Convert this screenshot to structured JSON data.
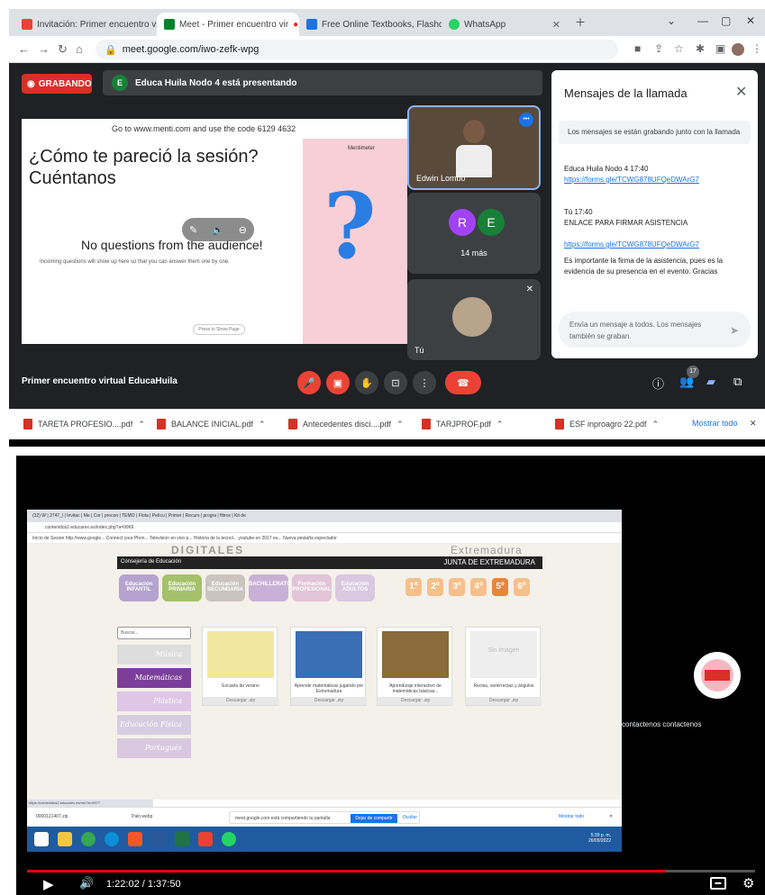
{
  "browser": {
    "tabs": [
      {
        "label": "Invitación: Primer encuentro virt",
        "color": "#ea4335"
      },
      {
        "label": "Meet - Primer encuentro vir",
        "color": "#00832d"
      },
      {
        "label": "Free Online Textbooks, Flashcard",
        "color": "#1a73e8"
      },
      {
        "label": "WhatsApp",
        "color": "#25d366"
      }
    ],
    "url": "meet.google.com/iwo-zefk-wpg"
  },
  "meet": {
    "recording_label": "GRABANDO",
    "presenter_initial": "E",
    "presenting_text": "Educa Huila Nodo 4 está presentando",
    "meeting_title": "Primer encuentro virtual EducaHuila",
    "participants_badge": "17",
    "slide": {
      "code_line": "Go to www.menti.com and use the code 6129 4632",
      "question": "¿Cómo te pareció la sesión? Cuéntanos",
      "brand": "Mentimeter",
      "qmark": "?",
      "no_questions": "No questions from the audience!",
      "incoming": "Incoming questions will show up here so that you can answer them one by one.",
      "small_btn": "Press to Show Page"
    },
    "tiles": {
      "t1_name": "Edwin Lombo",
      "t2_initials": [
        "R",
        "E"
      ],
      "t2_more": "14 más",
      "t3_name": "Tú"
    },
    "chat": {
      "title": "Mensajes de la llamada",
      "note": "Los mensajes se están grabando junto con la llamada",
      "m1_sender": "Educa Huila Nodo 4  17:40",
      "m1_link": "https://forms.gle/TCWG878UFQeDWArG7",
      "m2_sender": "Tú  17:40",
      "m2_text": "ENLACE PARA FIRMAR ASISTENCIA",
      "m2_link": "https://forms.gle/TCWG878UFQeDWArG7",
      "m2_text2": "Es importante la firma de la asistencia, pues es la evidencia de su presencia en el evento. Gracias",
      "input_placeholder": "Envía un mensaje a todos. Los mensajes también se graban."
    }
  },
  "downloads": {
    "items": [
      "TARETA PROFESIO....pdf",
      "BALANCE INICIAL.pdf",
      "Antecedentes disci....pdf",
      "TARJPROF.pdf",
      "ESF inproagro 22.pdf"
    ],
    "show_all": "Mostrar todo"
  },
  "shared": {
    "tabs_text": "(32) W  |  2747_l  |  Invitac  |  Me  |  Cor  |  procon  |  TEMO  |  Flota  |  Pelícu  |  Primer  |  Recurs  |  progra  |  filtros  |  Kit de",
    "url": "contenidos2.educarex.es/index.php?a=9969",
    "bookmarks": "Inicio de Sesion   http://www.google...   Connect your Phon...   Television en vivo p...   Historia de la tecnol...   youtube en 2017 eu...   Nueva pestaña   espectador",
    "brand_left": "DIGITALES",
    "brand_right": "Extremadura",
    "header_left": "Consejería de Educación",
    "header_right": "JUNTA DE EXTREMADURA",
    "levels": [
      "Educación INFANTIL",
      "Educación PRIMARIA",
      "Educación SECUNDARIA",
      "BACHILLERATO",
      "Formación PROFESIONAL",
      "Educación ADULTOS"
    ],
    "grades": [
      "1º",
      "2º",
      "3º",
      "4º",
      "5º",
      "6º"
    ],
    "search_placeholder": "Buscar...",
    "subjects": [
      "Música",
      "Matemáticas",
      "Plástica",
      "Educación Física",
      "Portugués"
    ],
    "cards": [
      {
        "caption": "Escuela de verano",
        "dl": "Descargar .zip"
      },
      {
        "caption": "Aprende matemáticas jugando por Extremadura",
        "dl": "Descargar .zip"
      },
      {
        "caption": "Aprendizaje interactivo de matemáticas básicas...",
        "dl": "Descargar .zip"
      },
      {
        "caption": "Rectas, semirrectas y ángulos",
        "dl": "Descargar .zip",
        "placeholder": "Sin imagen"
      }
    ],
    "status_url": "https://contenidos2.educarex.es/mr/?a=9977",
    "dl_item1": "0000121407.zip",
    "dl_item2": "Palo.webp",
    "share_text": "meet.google.com está compartiendo tu pantalla.",
    "share_stop": "Dejar de compartir",
    "share_hide": "Ocultar",
    "show_all": "Mostrar todo",
    "clock": "5:39 p. m.\n26/09/2022"
  },
  "player": {
    "side_name": "contactenos contactenos",
    "time": "1:22:02 / 1:37:50",
    "progress": 0.877
  },
  "colors": {
    "record_red": "#d93025",
    "meet_bg": "#202124",
    "accent_blue": "#1a73e8"
  }
}
